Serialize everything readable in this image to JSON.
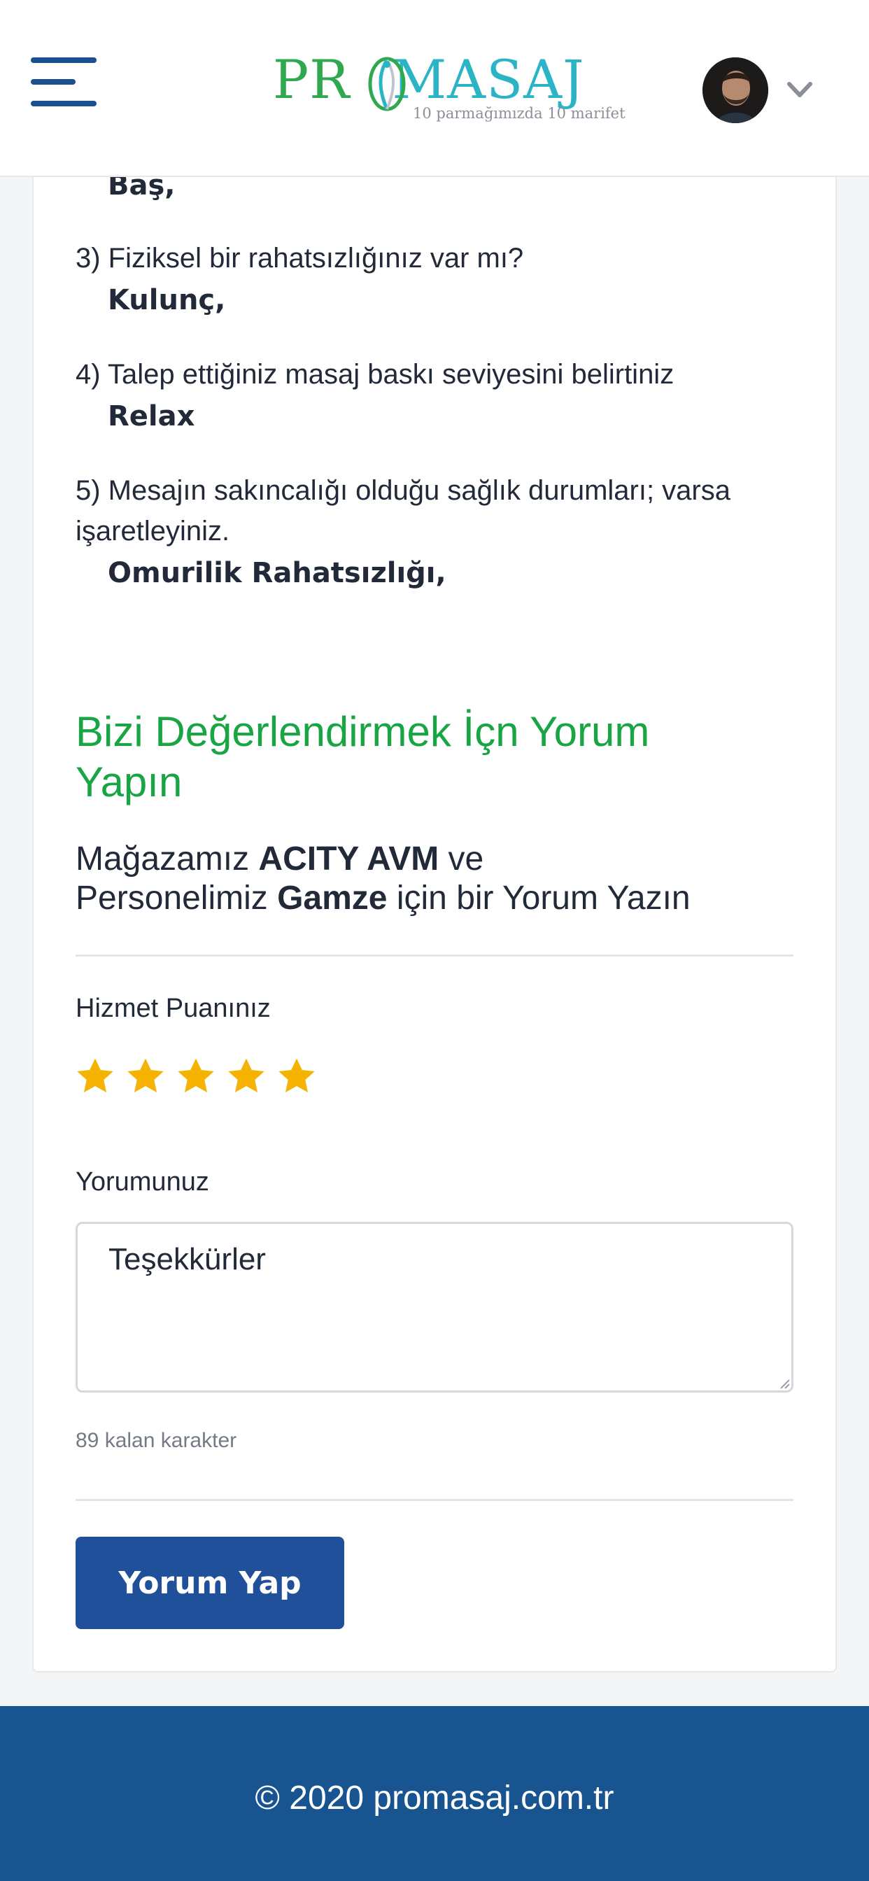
{
  "header": {
    "logo_text_left": "PR",
    "logo_text_right": "MASAJ",
    "logo_tagline": "10 parmağımızda 10 marifet",
    "menu_icon": "hamburger-menu-icon",
    "avatar_icon": "user-avatar",
    "dropdown_icon": "chevron-down-icon"
  },
  "questionnaire": {
    "partial_answer": "Baş,",
    "items": [
      {
        "question": "3) Fiziksel bir rahatsızlığınız var mı?",
        "answer": "Kulunç,"
      },
      {
        "question": "4) Talep ettiğiniz masaj baskı seviyesini belirtiniz",
        "answer": "Relax"
      },
      {
        "question_line1": "5) Mesajın sakıncalığı olduğu sağlık durumları; varsa",
        "question_line2": "işaretleyiniz.",
        "answer": "Omurilik Rahatsızlığı,"
      }
    ]
  },
  "review": {
    "heading_line1": "Bizi Değerlendirmek İçn Yorum",
    "heading_line2": "Yapın",
    "subtitle": {
      "p1": "Mağazamız ",
      "store": "ACITY AVM",
      "p2": " ve",
      "p3": "Personelimiz ",
      "staff": "Gamze",
      "p4": " için bir Yorum Yazın"
    },
    "rating_label": "Hizmet Puanınız",
    "rating": 5,
    "rating_max": 5,
    "star_color": "#f5b301",
    "comment_label": "Yorumunuz",
    "comment_value": "Teşekkürler",
    "remaining_text": "89 kalan karakter",
    "submit_label": "Yorum Yap"
  },
  "footer": {
    "text": "© 2020 promasaj.com.tr"
  },
  "colors": {
    "heading_green": "#1aa544",
    "primary_blue": "#1f5099",
    "footer_blue": "#175490"
  }
}
